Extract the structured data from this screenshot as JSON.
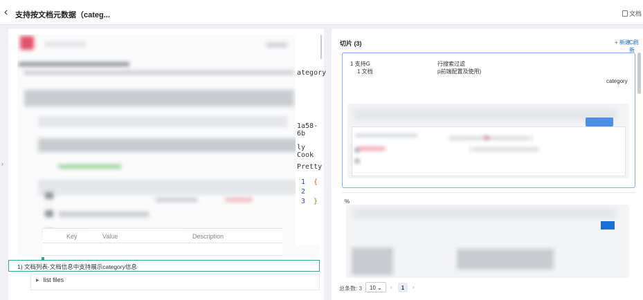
{
  "header": {
    "title": "支持按文档元数据（categ...",
    "doc_button": "文档"
  },
  "left": {
    "embedded_strip": {
      "category": "ategory",
      "id_fragment": "1a58-6b",
      "tab_fragment": "ly Cook",
      "pretty": "Pretty",
      "lines": [
        "1",
        "2",
        "3"
      ],
      "brace_open": "{",
      "brace_close": "}"
    },
    "kv_table": {
      "key": "Key",
      "value": "Value",
      "description": "Description"
    },
    "caption": "1) 文档列表-文档信息中支持展示category信息",
    "list_files": "list files"
  },
  "right": {
    "chunks_title": "切片 (3)",
    "new_button": "+ 新建",
    "other_button": "C刷新",
    "card1": {
      "line1_a": "1 支持G",
      "line1_b": "行搜索过滤",
      "line2_a": "1 文档",
      "line2_b": "p前端配置及使用)",
      "category": "category"
    },
    "card2_mark": "%",
    "pagination": {
      "total_label": "总条数: 3",
      "page_size": "10",
      "current_page": "1"
    }
  }
}
